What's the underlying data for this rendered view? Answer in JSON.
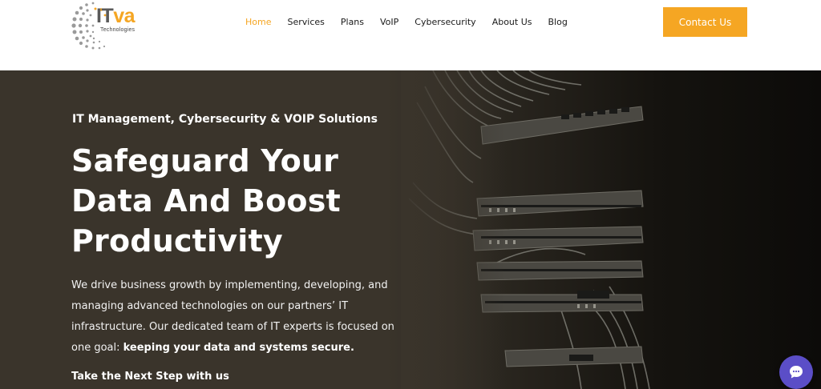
{
  "brand": {
    "name_part1": "IT",
    "name_part2": "va",
    "tagline": "Technologies",
    "accent_color": "#f5a623"
  },
  "nav": {
    "items": [
      {
        "label": "Home",
        "active": true
      },
      {
        "label": "Services"
      },
      {
        "label": "Plans"
      },
      {
        "label": "VoIP"
      },
      {
        "label": "Cybersecurity"
      },
      {
        "label": "About Us"
      },
      {
        "label": "Blog"
      }
    ],
    "cta_label": "Contact Us"
  },
  "hero": {
    "kicker": "IT Management, Cybersecurity & VOIP Solutions",
    "title_lines": [
      "Safeguard Your",
      "Data And Boost",
      "Productivity"
    ],
    "body_lines": [
      "We drive business growth by implementing, developing, and",
      "managing advanced technologies on our partners’ IT",
      "infrastructure. Our dedicated team of IT experts is focused on"
    ],
    "body_last_plain": "one goal: ",
    "body_last_bold": "keeping your data and systems secure.",
    "next_step": "Take the Next Step with us",
    "background_image": "server-rack-photo"
  },
  "chat": {
    "icon": "chat-bubble-icon",
    "color": "#5b4ec7"
  }
}
